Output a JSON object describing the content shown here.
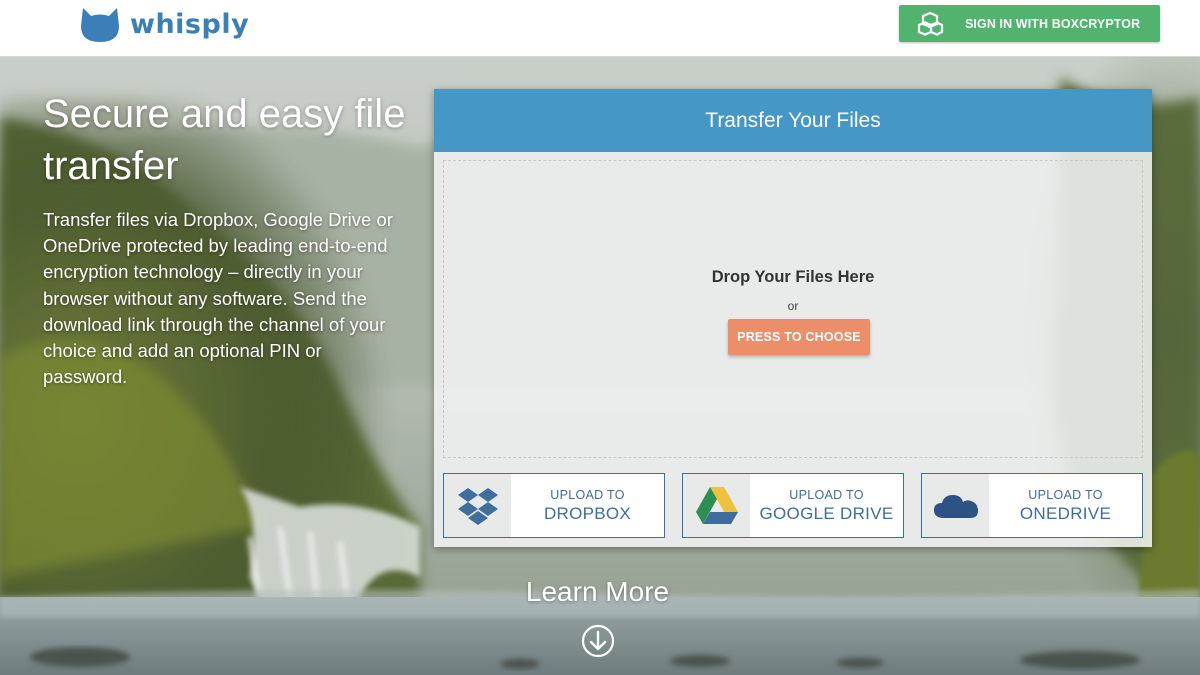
{
  "header": {
    "brand": "whisply",
    "signin_label": "SIGN IN WITH BOXCRYPTOR"
  },
  "hero": {
    "title": "Secure and easy file transfer",
    "description": "Transfer files via Dropbox, Google Drive or OneDrive protected by leading end-to-end encryption technology – directly in your browser without any software. Send the download link through the channel of your choice and add an optional PIN or password."
  },
  "panel": {
    "title": "Transfer Your Files",
    "drop_title": "Drop Your Files Here",
    "or_text": "or",
    "choose_label": "PRESS TO CHOOSE",
    "uploads": [
      {
        "line1": "UPLOAD TO",
        "line2": "DROPBOX",
        "icon": "dropbox-icon"
      },
      {
        "line1": "UPLOAD TO",
        "line2": "GOOGLE DRIVE",
        "icon": "google-drive-icon"
      },
      {
        "line1": "UPLOAD TO",
        "line2": "ONEDRIVE",
        "icon": "onedrive-icon"
      }
    ]
  },
  "footer": {
    "learn_more": "Learn More",
    "icon": "arrow-down-circle-icon"
  },
  "colors": {
    "brand_blue": "#3a7fb8",
    "signin_green": "#52b36e",
    "panel_header": "#4597c6",
    "choose_orange": "#ec8e6a",
    "upload_text": "#3f6d9e"
  }
}
